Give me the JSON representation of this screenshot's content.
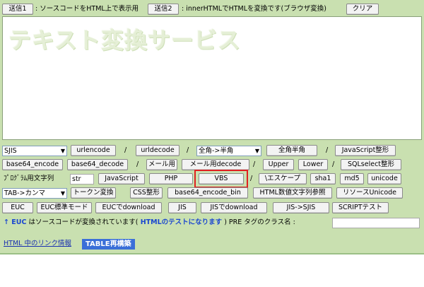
{
  "header": {
    "send1": "送信1",
    "send1_desc": ": ソースコードをHTML上で表示用",
    "send2": "送信2",
    "send2_desc": ": innerHTMLでHTMLを変換です(ブラウザ変換)",
    "clear": "クリア"
  },
  "textarea": {
    "watermark": "テキスト変換サービス"
  },
  "row1": {
    "encoding_select": "SJIS",
    "urlencode": "urlencode",
    "urldecode": "urldecode",
    "width_select": "全角->半角",
    "zenkaku_hankaku": "全角半角",
    "js_format": "JavaScript整形",
    "sep": "/"
  },
  "row2": {
    "base64_encode": "base64_encode",
    "base64_decode": "base64_decode",
    "mail": "メール用",
    "mail_decode": "メール用decode",
    "upper": "Upper",
    "lower": "Lower",
    "sql_format": "SQLselect整形"
  },
  "row3": {
    "label": "ﾌﾟﾛｸﾞﾗﾑ用文字列",
    "str_value": "str",
    "javascript": "JavaScript",
    "php": "PHP",
    "vbs": "VBS",
    "escape": "\\エスケープ",
    "sha1": "sha1",
    "md5": "md5",
    "unicode": "unicode"
  },
  "row4": {
    "tab_select": "TAB->カンマ",
    "token": "トークン変換",
    "css_format": "CSS整形",
    "base64_encode_bin": "base64_encode_bin",
    "html_numeric": "HTML数値文字列参照",
    "resource_unicode": "リソースUnicode"
  },
  "row5": {
    "euc": "EUC",
    "euc_standard": "EUC標準モード",
    "euc_download": "EUCでdownload",
    "jis": "JIS",
    "jis_download": "JISでdownload",
    "jis_sjis": "JIS->SJIS",
    "script_test": "SCRIPTテスト"
  },
  "status": {
    "arrow_euc": "↑ EUC",
    "text1": " はソースコードが変換されています(",
    "html_test": " HTMLのテストになります",
    "text2": " ) ",
    "pre_label": "PRE タグのクラス名 :",
    "pre_value": ""
  },
  "footer": {
    "link_text": "HTML 中のリンク情報",
    "table_rebuild": "TABLE再構築"
  },
  "colors": {
    "panel": "#c9e0b0",
    "highlight": "#e02020",
    "accent_blue": "#1a46d0"
  }
}
